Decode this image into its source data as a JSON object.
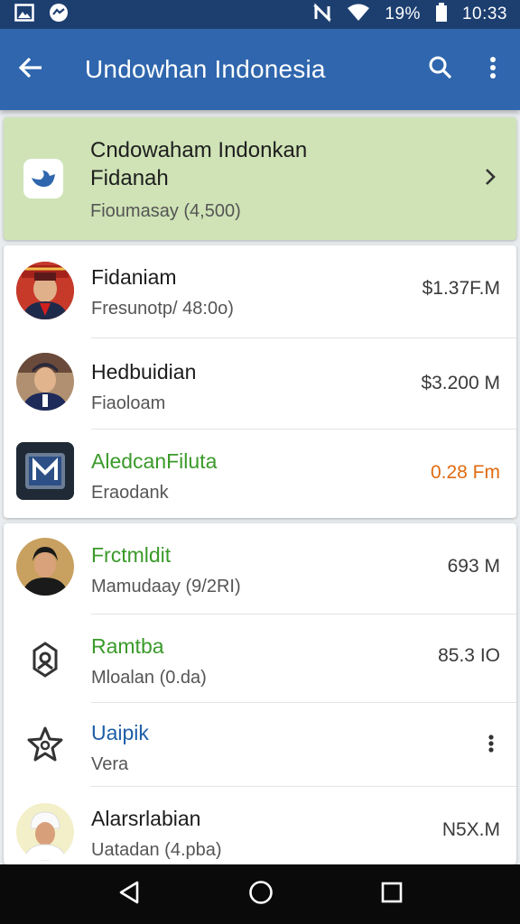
{
  "status": {
    "battery": "19%",
    "time": "10:33"
  },
  "app_bar": {
    "title": "Undowhan Indonesia"
  },
  "banner": {
    "title_line1": "Cndowaham Indonkan",
    "title_line2": "Fidanah",
    "subtitle": "Fioumasay (4,500)"
  },
  "list1": [
    {
      "name": "Fidaniam",
      "sub": "Fresunotp/ 48:0o)",
      "value": "$1.37F.M"
    },
    {
      "name": "Hedbuidian",
      "sub": "Fiaoloam",
      "value": "$3.200 M"
    },
    {
      "name": "AledcanFiluta",
      "sub": "Eraodank",
      "value": "0.28 Fm"
    }
  ],
  "list2": [
    {
      "name": "Frctmldit",
      "sub": "Mamudaay (9/2RI)",
      "value": "693 M"
    },
    {
      "name": "Ramtba",
      "sub": "Mloalan (0.da)",
      "value": "85.3 IO"
    },
    {
      "name": "Uaipik",
      "sub": "Vera",
      "value": ""
    },
    {
      "name": "Alarsrlabian",
      "sub": "Uatadan (4.pba)",
      "value": "N5X.M"
    }
  ],
  "colors": {
    "app_bar": "#2f66ad",
    "status_bar": "#1d3f70",
    "banner_bg": "#cfe3b6",
    "green": "#3a9a2a",
    "blue": "#1d5fa8",
    "orange": "#e06b10"
  },
  "icons": [
    "image-icon",
    "messenger-icon",
    "mute-icon",
    "wifi-icon",
    "battery-icon",
    "back-arrow-icon",
    "search-icon",
    "more-vert-icon",
    "bird-icon",
    "chevron-right-icon",
    "badge-icon",
    "star-icon",
    "nav-back-icon",
    "nav-home-icon",
    "nav-recents-icon"
  ]
}
